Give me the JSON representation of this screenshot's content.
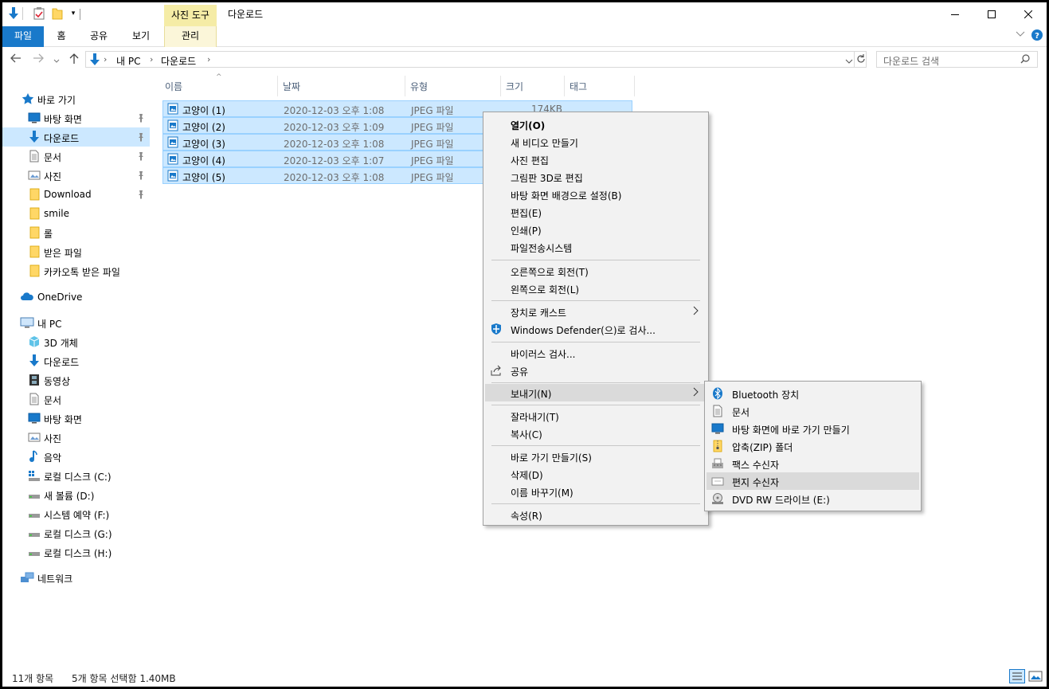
{
  "titlebar": {
    "contextual_tab": "사진 도구",
    "title": "다운로드"
  },
  "ribbon": {
    "tabs": [
      "파일",
      "홈",
      "공유",
      "보기",
      "관리"
    ]
  },
  "address": {
    "crumbs": [
      "내 PC",
      "다운로드"
    ],
    "search_placeholder": "다운로드 검색"
  },
  "nav": {
    "quick_access": "바로 가기",
    "quick_items": [
      "바탕 화면",
      "다운로드",
      "문서",
      "사진",
      "Download",
      "smile",
      "롤",
      "받은 파일",
      "카카오톡 받은 파일"
    ],
    "onedrive": "OneDrive",
    "this_pc": "내 PC",
    "pc_items": [
      "3D 개체",
      "다운로드",
      "동영상",
      "문서",
      "바탕 화면",
      "사진",
      "음악",
      "로컬 디스크 (C:)",
      "새 볼륨 (D:)",
      "시스템 예약 (F:)",
      "로컬 디스크 (G:)",
      "로컬 디스크 (H:)"
    ],
    "network": "네트워크"
  },
  "columns": [
    "이름",
    "날짜",
    "유형",
    "크기",
    "태그"
  ],
  "files": [
    {
      "name": "고양이 (1)",
      "date": "2020-12-03 오후 1:08",
      "type": "JPEG 파일",
      "size": "174KB"
    },
    {
      "name": "고양이 (2)",
      "date": "2020-12-03 오후 1:09",
      "type": "JPEG 파일",
      "size": ""
    },
    {
      "name": "고양이 (3)",
      "date": "2020-12-03 오후 1:08",
      "type": "JPEG 파일",
      "size": ""
    },
    {
      "name": "고양이 (4)",
      "date": "2020-12-03 오후 1:07",
      "type": "JPEG 파일",
      "size": ""
    },
    {
      "name": "고양이 (5)",
      "date": "2020-12-03 오후 1:08",
      "type": "JPEG 파일",
      "size": ""
    }
  ],
  "context_menu": {
    "open": "열기(O)",
    "new_video": "새 비디오 만들기",
    "edit_photo": "사진 편집",
    "paint3d": "그림판 3D로 편집",
    "set_bg": "바탕 화면 배경으로 설정(B)",
    "edit": "편집(E)",
    "print": "인쇄(P)",
    "file_transfer": "파일전송시스템",
    "rotate_right": "오른쪽으로 회전(T)",
    "rotate_left": "왼쪽으로 회전(L)",
    "cast": "장치로 캐스트",
    "defender": "Windows Defender(으)로 검사...",
    "virus_scan": "바이러스 검사...",
    "share": "공유",
    "send_to": "보내기(N)",
    "cut": "잘라내기(T)",
    "copy": "복사(C)",
    "shortcut": "바로 가기 만들기(S)",
    "delete": "삭제(D)",
    "rename": "이름 바꾸기(M)",
    "properties": "속성(R)"
  },
  "sendto_menu": {
    "bluetooth": "Bluetooth 장치",
    "documents": "문서",
    "desktop_shortcut": "바탕 화면에 바로 가기 만들기",
    "zip": "압축(ZIP) 폴더",
    "fax": "팩스 수신자",
    "mail": "편지 수신자",
    "dvd": "DVD RW 드라이브 (E:)"
  },
  "status": {
    "count": "11개 항목",
    "selected": "5개 항목 선택함 1.40MB"
  },
  "colors": {
    "accent": "#1979ca",
    "selection": "#cce8ff",
    "selection_border": "#99d1ff",
    "contextual": "#f5eca6",
    "menu_bg": "#f2f2f2",
    "menu_highlight": "#dadada"
  }
}
